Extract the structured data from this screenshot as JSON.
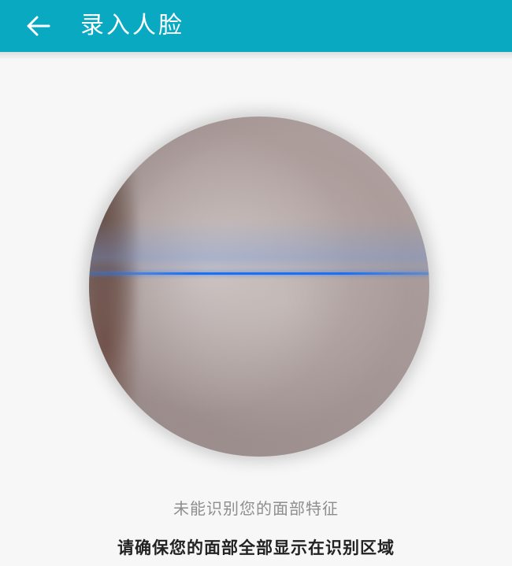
{
  "header": {
    "back_icon": "arrow-left-icon",
    "title": "录入人脸"
  },
  "camera": {
    "scan_line_color": "#1e6ef0"
  },
  "hints": {
    "status": "未能识别您的面部特征",
    "instruction": "请确保您的面部全部显示在识别区域"
  },
  "colors": {
    "app_bar": "#0aa9c2",
    "background": "#f7f7f7"
  }
}
